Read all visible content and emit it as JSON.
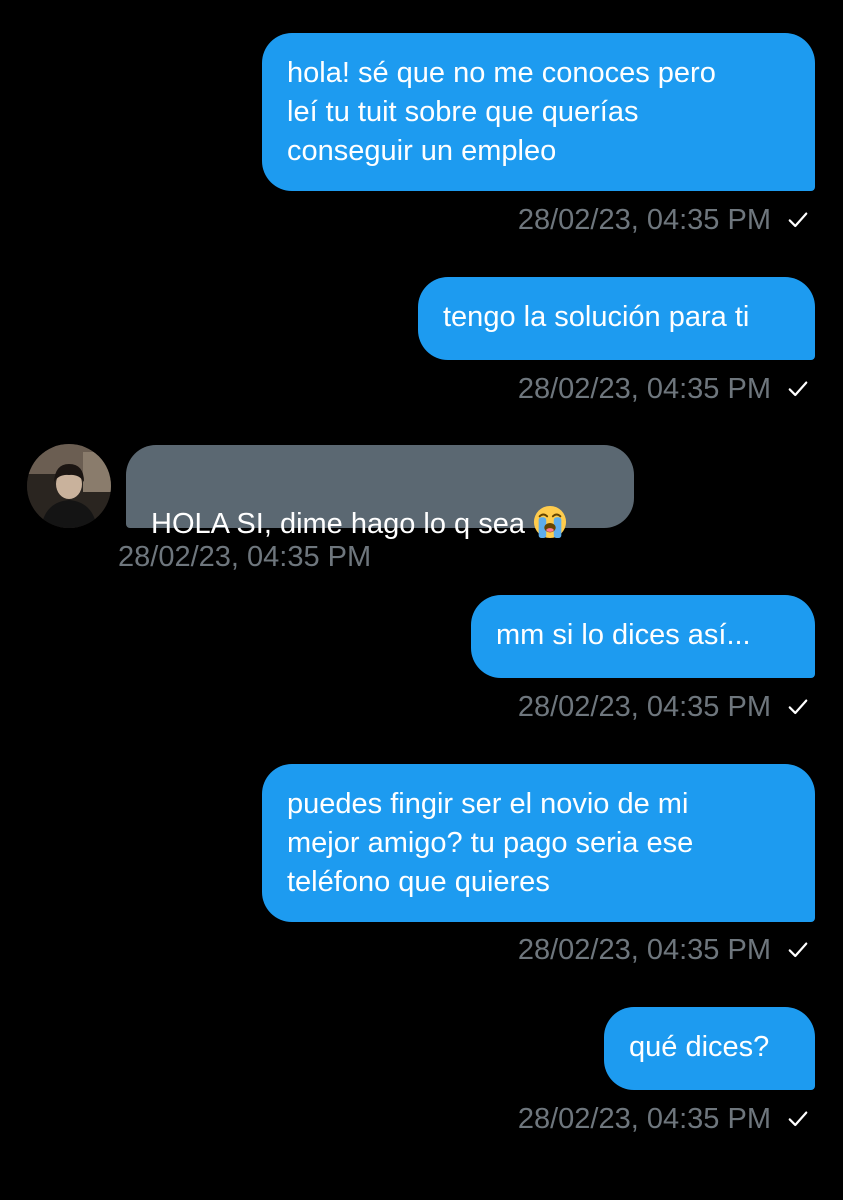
{
  "conversation": {
    "messages": [
      {
        "direction": "sent",
        "text": "hola! sé que no me conoces pero\nleí tu tuit sobre que querías\nconseguir un empleo",
        "timestamp": "28/02/23, 04:35 PM"
      },
      {
        "direction": "sent",
        "text": "tengo la solución para ti",
        "timestamp": "28/02/23, 04:35 PM"
      },
      {
        "direction": "received",
        "text": "HOLA SI, dime hago lo q sea",
        "emoji": "loudly-crying-face-emoji",
        "timestamp": "28/02/23, 04:35 PM"
      },
      {
        "direction": "sent",
        "text": "mm si lo dices así...",
        "timestamp": "28/02/23, 04:35 PM"
      },
      {
        "direction": "sent",
        "text": "puedes fingir ser el novio de mi\nmejor amigo? tu pago seria ese\nteléfono que quieres",
        "timestamp": "28/02/23, 04:35 PM"
      },
      {
        "direction": "sent",
        "text": "qué dices?",
        "timestamp": "28/02/23, 04:35 PM"
      }
    ]
  },
  "icons": {
    "sent_status": "checkmark-icon",
    "avatar": "user-avatar"
  },
  "colors": {
    "background": "#000000",
    "sent_bubble": "#1d9bf0",
    "received_bubble": "#5b6872",
    "timestamp": "#6e767d",
    "message_text": "#ffffff"
  }
}
